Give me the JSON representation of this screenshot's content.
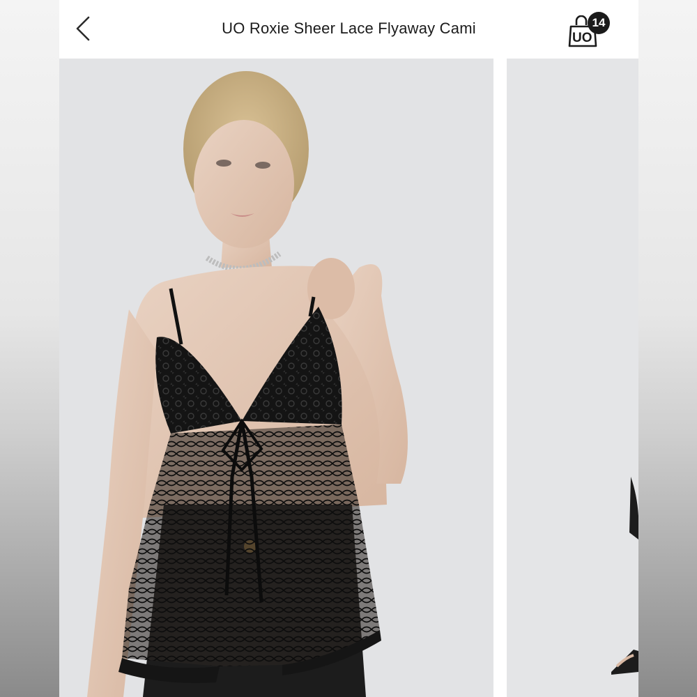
{
  "header": {
    "title": "UO Roxie Sheer Lace Flyaway Cami",
    "bag_logo_text": "UO",
    "bag_count": "14"
  },
  "icons": {
    "back": "chevron-left-icon",
    "bag": "shopping-bag-icon"
  },
  "colors": {
    "header_bg": "#ffffff",
    "title_text": "#1b1b1b",
    "badge_bg": "#1b1b1b",
    "photo_bg": "#e2e3e5"
  }
}
